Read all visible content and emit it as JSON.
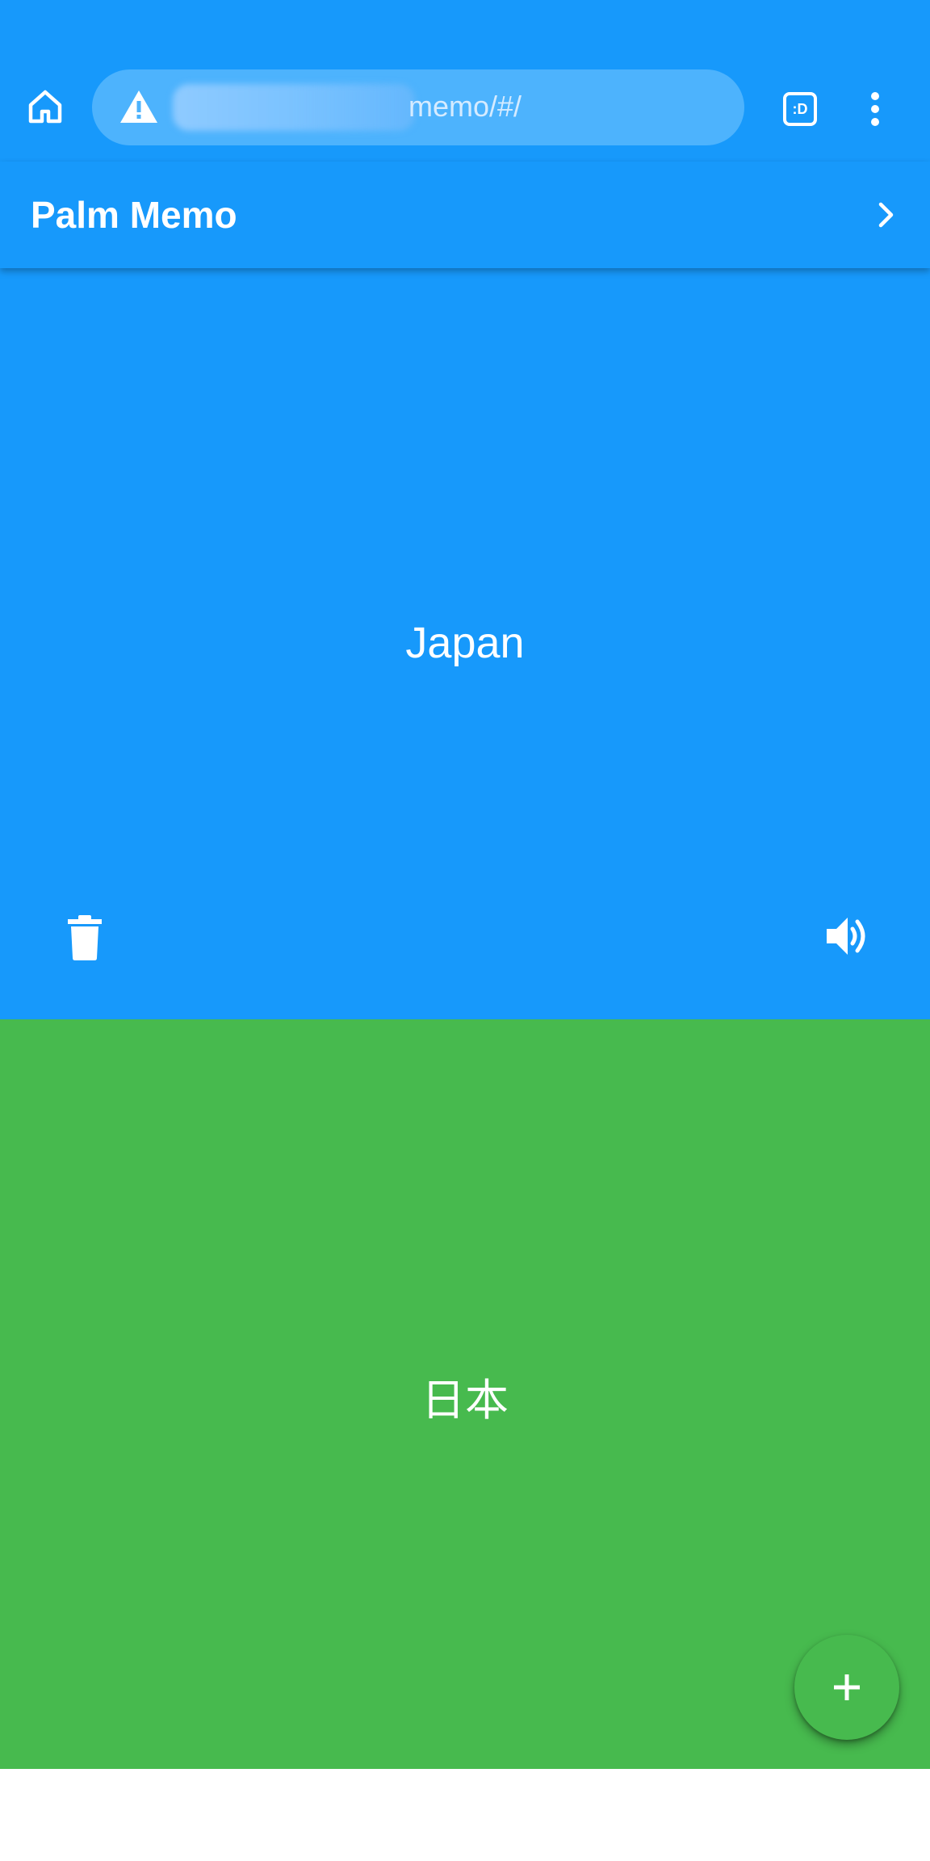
{
  "browser": {
    "url_visible_suffix": "memo/#/",
    "tab_label": ":D"
  },
  "app": {
    "title": "Palm Memo"
  },
  "cards": {
    "front": {
      "text": "Japan",
      "color": "#1799fb"
    },
    "back": {
      "text": "日本",
      "color": "#47ba4e"
    }
  },
  "icons": {
    "home": "home-icon",
    "warning": "warning-icon",
    "tabs": "tab-switcher-icon",
    "menu": "more-vert-icon",
    "next": "chevron-right-icon",
    "delete": "trash-icon",
    "speak": "speaker-icon",
    "add": "plus-icon"
  }
}
